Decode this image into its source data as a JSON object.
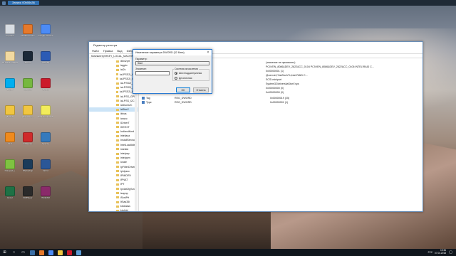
{
  "window_bar": {
    "title": "Запись 00h06s36"
  },
  "regedit": {
    "title": "Редактор реестра",
    "menu": [
      "Файл",
      "Правка",
      "Вид",
      "Избранное",
      "Справка"
    ],
    "address": "Компьютер\\HKEY_LOCAL_MACHINE\\SYSTEM\\CurrentControlSet\\Services\\iaStorV",
    "tree": [
      "i8042prt",
      "iagpio",
      "iai2c",
      "iaLPSS2i_GPIO",
      "iaLPSS2i_GPIO",
      "iaLPSS2i_I2C",
      "iaLPSS2i_I2C",
      "iaLPSS2i_GPIO",
      "iaLPSS_GPIO",
      "iaLPSS_I2C",
      "iaStorAVC",
      "iaStorV",
      "ibbus",
      "icssvc",
      "IDriverT",
      "IKEEXT",
      "IndirectKmd",
      "inteliaca",
      "InstallService",
      "IntelLoadIdle",
      "intelide",
      "intelpep",
      "intelppm",
      "iorate",
      "IpFilterDriver",
      "iphlpsvc",
      "IPMIDRV",
      "IPNAT",
      "IPT",
      "IpxlatCfgSvc",
      "isapnp",
      "iScsiPrt",
      "ItSas35i",
      "kbdclass",
      "kbdhid"
    ],
    "selected_index": 11,
    "values_partial": [
      {
        "name": "",
        "type": "",
        "data": "(значение не присвоено)"
      },
      {
        "name": "",
        "type": "",
        "data": "PCI\\VEN_8086&DEV_2822&CC_0104 PCI\\VEN_8086&DEV_2822&CC_0106 INTEL\\RAID C..."
      },
      {
        "name": "",
        "type": "",
        "data": "0x00000001 (1)"
      },
      {
        "name": "",
        "type": "",
        "data": "@oem.inf,%iaStorV%;Intel RAID C..."
      },
      {
        "name": "",
        "type": "",
        "data": "SCSI miniport"
      },
      {
        "name": "",
        "type": "",
        "data": "System32\\drivers\\iaStorV.sys"
      },
      {
        "name": "",
        "type": "",
        "data": "0x00000000 (0)"
      },
      {
        "name": "",
        "type": "",
        "data": "0x00000000 (0)"
      }
    ],
    "values": [
      {
        "name": "Tag",
        "type": "REG_DWORD",
        "data": "0x00000019 (25)"
      },
      {
        "name": "Type",
        "type": "REG_DWORD",
        "data": "0x00000001 (1)"
      }
    ]
  },
  "dialog": {
    "title": "Изменение параметра DWORD (32 бита)",
    "param_label": "Параметр:",
    "param_value": "Start",
    "value_label": "Значение:",
    "value_value": "",
    "base_label": "Система исчисления",
    "radio_hex": "Шестнадцатеричная",
    "radio_dec": "Десятичная",
    "selected_base": "hex",
    "ok": "ОК",
    "cancel": "Отмена"
  },
  "desktop_icons": [
    {
      "label": "Корзина",
      "color": "#d8dde3"
    },
    {
      "label": "Mozilla Firefox",
      "color": "#e6792b"
    },
    {
      "label": "Google Chrome",
      "color": "#4c8bf5"
    },
    {
      "label": "ОНЛАЙН ИГРЫ",
      "color": "#f2d9a0"
    },
    {
      "label": "Steam",
      "color": "#1b2838"
    },
    {
      "label": "AIDA64",
      "color": "#2b5bb5"
    },
    {
      "label": "Skype",
      "color": "#00aff0"
    },
    {
      "label": "uTorrent",
      "color": "#76b83f"
    },
    {
      "label": "Opera",
      "color": "#cc1a2b"
    },
    {
      "label": "Диск D",
      "color": "#f1c640"
    },
    {
      "label": "Документы",
      "color": "#f1c640"
    },
    {
      "label": "Total Commander",
      "color": "#f2ec5a"
    },
    {
      "label": "VLC",
      "color": "#f08a1c"
    },
    {
      "label": "CCleaner",
      "color": "#d02a2a"
    },
    {
      "label": "Speccy",
      "color": "#357abd"
    },
    {
      "label": "Notepad++",
      "color": "#7fc241"
    },
    {
      "label": "Photoshop",
      "color": "#1b3b5a"
    },
    {
      "label": "Word",
      "color": "#2b5797"
    },
    {
      "label": "Excel",
      "color": "#1e7145"
    },
    {
      "label": "KMPlayer",
      "color": "#2a2a2a"
    },
    {
      "label": "WinRAR",
      "color": "#8a2a6a"
    }
  ],
  "taskbar": {
    "start_icon": "windows-logo-icon",
    "time": "19:36",
    "date": "07.04.2018",
    "lang": "РУС"
  }
}
